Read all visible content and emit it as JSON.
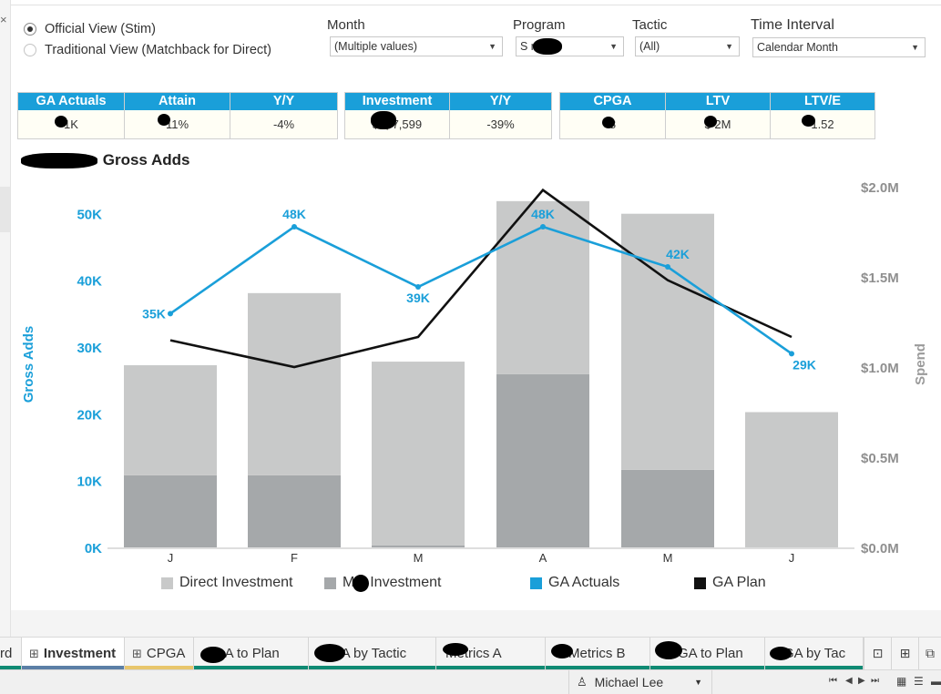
{
  "view_options": [
    {
      "label": "Official View (Stim)",
      "selected": true
    },
    {
      "label": "Traditional View (Matchback for Direct)",
      "selected": false
    }
  ],
  "filters": {
    "month": {
      "label": "Month",
      "value": "(Multiple values)"
    },
    "program": {
      "label": "Program",
      "value": "S        re"
    },
    "tactic": {
      "label": "Tactic",
      "value": "(All)"
    },
    "time_interval": {
      "label": "Time Interval",
      "value": "Calendar Month"
    }
  },
  "kpis": {
    "ga_actuals": {
      "label": "GA Actuals",
      "value": "1K"
    },
    "attain": {
      "label": "Attain",
      "value": "11%"
    },
    "ga_yy": {
      "label": "Y/Y",
      "value": "-4%"
    },
    "investment": {
      "label": "Investment",
      "value": "$1,  7,599"
    },
    "inv_yy": {
      "label": "Y/Y",
      "value": "-39%"
    },
    "cpga": {
      "label": "CPGA",
      "value": "8"
    },
    "ltv": {
      "label": "LTV",
      "value": "$  2M"
    },
    "ltv_e": {
      "label": "LTV/E",
      "value": "1.52"
    }
  },
  "chart_title_text": "Gross Adds",
  "chart_data": {
    "type": "bar",
    "categories": [
      "J",
      "F",
      "M",
      "A",
      "M",
      "J"
    ],
    "series": [
      {
        "name": "Direct Investment",
        "axis": "right",
        "stack": "spend",
        "values": [
          0.61,
          1.01,
          1.02,
          0.96,
          1.42,
          0.75
        ]
      },
      {
        "name": "M  s Investment",
        "axis": "right",
        "stack": "spend",
        "values": [
          0.4,
          0.4,
          0.01,
          0.96,
          0.43,
          0.0
        ]
      },
      {
        "name": "GA Actuals",
        "type": "line",
        "axis": "left",
        "values": [
          35000,
          48000,
          39000,
          48000,
          42000,
          29000
        ],
        "data_labels": [
          "35K",
          "48K",
          "39K",
          "48K",
          "42K",
          "29K"
        ]
      },
      {
        "name": "GA Plan",
        "type": "line",
        "axis": "left",
        "values": [
          31000,
          27000,
          31500,
          53500,
          40000,
          31500
        ]
      }
    ],
    "ylabel": "Gross Adds",
    "y2label": "Spend",
    "ylim": [
      0,
      54000
    ],
    "y2lim": [
      0,
      2.0
    ],
    "y_ticks": [
      0,
      10000,
      20000,
      30000,
      40000,
      50000
    ],
    "y_tick_labels": [
      "0K",
      "10K",
      "20K",
      "30K",
      "40K",
      "50K"
    ],
    "y2_ticks": [
      0,
      0.5,
      1.0,
      1.5,
      2.0
    ],
    "y2_tick_labels": [
      "$0.0M",
      "$0.5M",
      "$1.0M",
      "$1.5M",
      "$2.0M"
    ],
    "colors": {
      "direct": "#c8c9c9",
      "media": "#a5a8aa",
      "actuals": "#1a9fd9",
      "plan": "#111111"
    },
    "legend_position": "bottom"
  },
  "tabs": [
    {
      "label": "rd"
    },
    {
      "label": "Investment",
      "active": true
    },
    {
      "label": "CPGA"
    },
    {
      "label": "  GA to Plan"
    },
    {
      "label": "  GA by Tactic"
    },
    {
      "label": "    Metrics A"
    },
    {
      "label": "   U Metrics B"
    },
    {
      "label": "  L GA to Plan"
    },
    {
      "label": "  GA by Tac"
    }
  ],
  "status": {
    "user": "Michael Lee"
  }
}
